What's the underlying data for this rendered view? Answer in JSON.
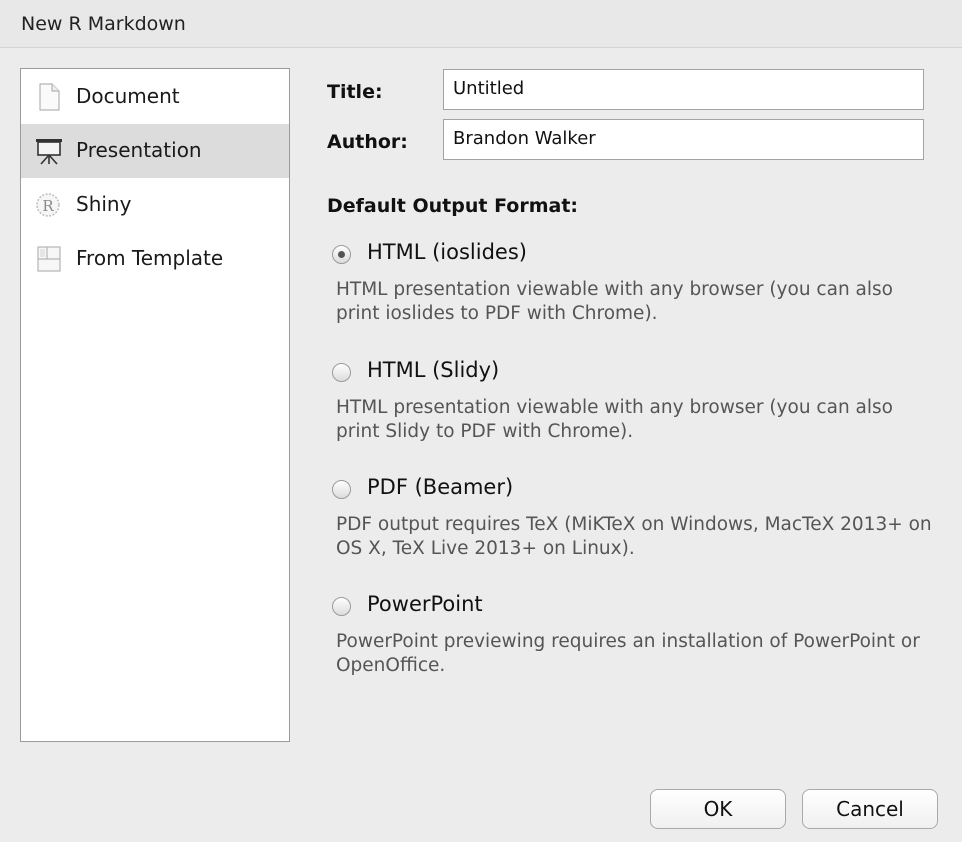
{
  "dialog": {
    "title": "New R Markdown"
  },
  "sidebar": {
    "items": [
      {
        "label": "Document",
        "icon": "document-icon",
        "selected": false
      },
      {
        "label": "Presentation",
        "icon": "presentation-easel-icon",
        "selected": true
      },
      {
        "label": "Shiny",
        "icon": "r-logo-icon",
        "selected": false
      },
      {
        "label": "From Template",
        "icon": "template-icon",
        "selected": false
      }
    ]
  },
  "form": {
    "title_label": "Title:",
    "title_value": "Untitled",
    "author_label": "Author:",
    "author_value": "Brandon Walker",
    "format_heading": "Default Output Format:"
  },
  "formats": [
    {
      "label": "HTML (ioslides)",
      "description": "HTML presentation viewable with any browser (you can also print ioslides to PDF with Chrome).",
      "checked": true
    },
    {
      "label": "HTML (Slidy)",
      "description": "HTML presentation viewable with any browser (you can also print Slidy to PDF with Chrome).",
      "checked": false
    },
    {
      "label": "PDF (Beamer)",
      "description": "PDF output requires TeX (MiKTeX on Windows, MacTeX 2013+ on OS X, TeX Live 2013+ on Linux).",
      "checked": false
    },
    {
      "label": "PowerPoint",
      "description": "PowerPoint previewing requires an installation of PowerPoint or OpenOffice.",
      "checked": false
    }
  ],
  "buttons": {
    "ok_label": "OK",
    "cancel_label": "Cancel"
  },
  "colors": {
    "background": "#ececec",
    "selected_row": "#dcdcdc",
    "description_text": "#555555"
  }
}
